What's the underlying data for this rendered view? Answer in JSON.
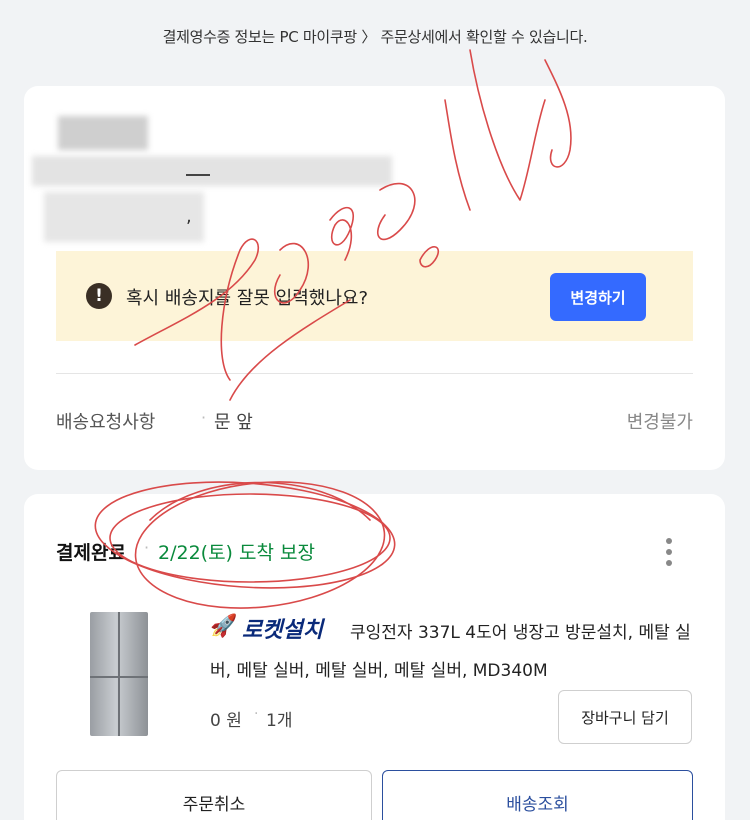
{
  "notice": "결제영수증 정보는 PC 마이쿠팡 〉 주문상세에서 확인할 수 있습니다.",
  "address_card": {
    "warning_text": "혹시 배송지를 잘못 입력했나요?",
    "change_button": "변경하기",
    "request_label": "배송요청사항",
    "request_value": "문 앞",
    "request_status": "변경불가"
  },
  "order_card": {
    "status": "결제완료",
    "arrival": "2/22(토) 도착 보장",
    "badge": "로켓설치",
    "product_name": "쿠잉전자 337L 4도어 냉장고 방문설치, 메탈 실버, 메탈 실버, 메탈 실버, 메탈 실버, MD340M",
    "price": "0 원",
    "quantity": "1개",
    "cart_button": "장바구니 담기",
    "cancel_button": "주문취소",
    "track_button": "배송조회"
  },
  "colors": {
    "primary": "#346aff",
    "arrival_green": "#0a8a3c",
    "warning_bg": "#fdf4d8",
    "scribble": "#d94a4a"
  }
}
